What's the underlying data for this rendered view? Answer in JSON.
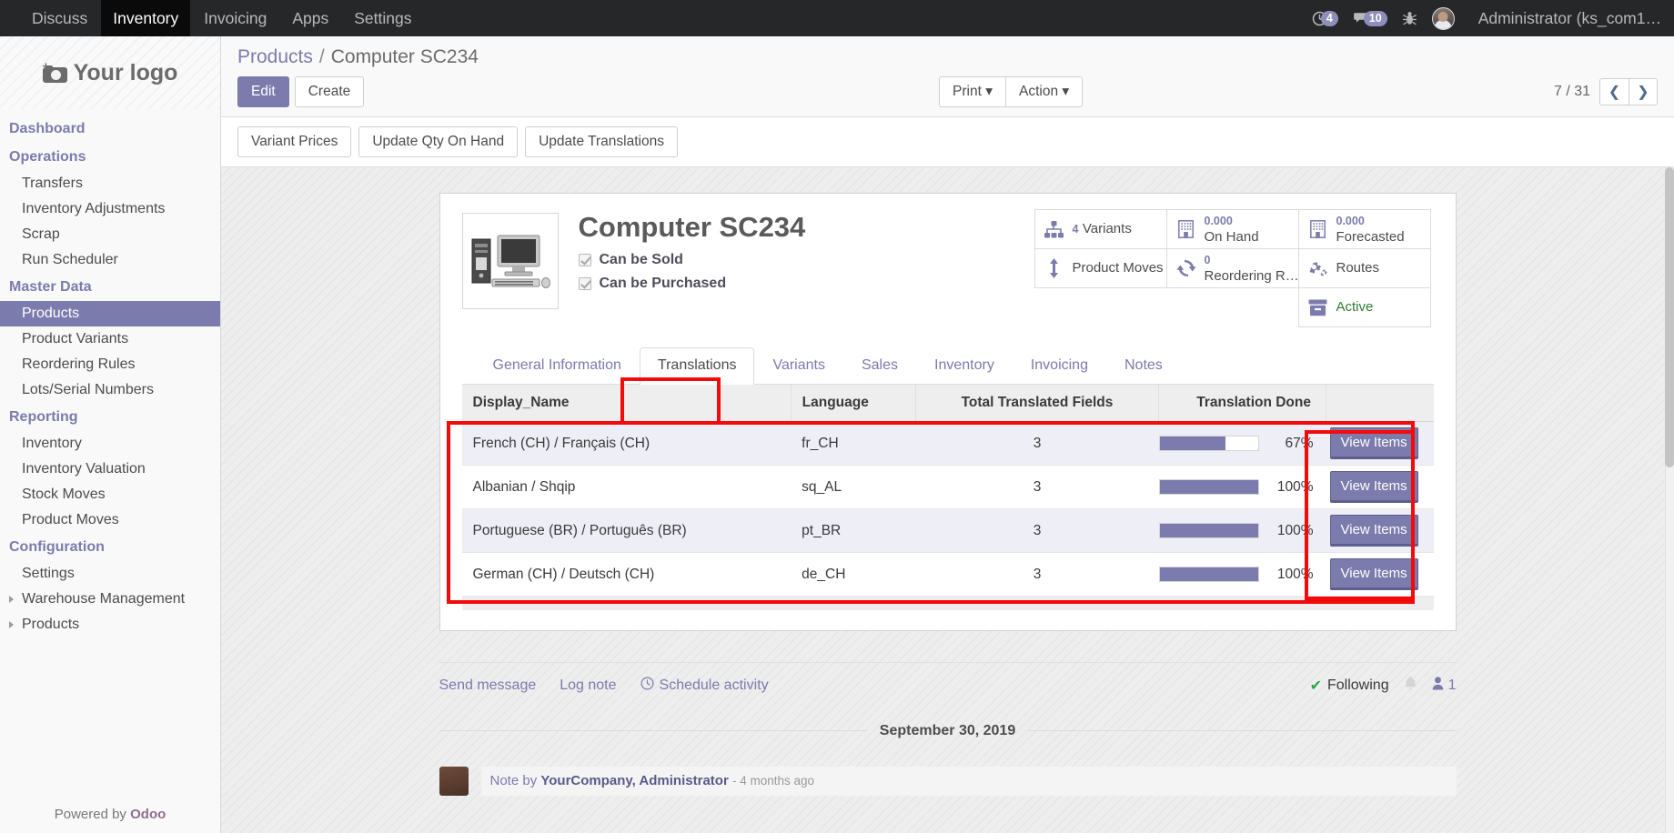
{
  "navbar": {
    "menus": [
      {
        "label": "Discuss",
        "active": false
      },
      {
        "label": "Inventory",
        "active": true
      },
      {
        "label": "Invoicing",
        "active": false
      },
      {
        "label": "Apps",
        "active": false
      },
      {
        "label": "Settings",
        "active": false
      }
    ],
    "activity_count": "4",
    "message_count": "10",
    "debug_icon": "bug-icon",
    "user_label": "Administrator (ks_com1…"
  },
  "sidebar": {
    "logo_text": "Your logo",
    "logo_icon": "camera-add-icon",
    "sections": [
      {
        "type": "header",
        "label": "Dashboard"
      },
      {
        "type": "header",
        "label": "Operations"
      },
      {
        "type": "link",
        "label": "Transfers"
      },
      {
        "type": "link",
        "label": "Inventory Adjustments"
      },
      {
        "type": "link",
        "label": "Scrap"
      },
      {
        "type": "link",
        "label": "Run Scheduler"
      },
      {
        "type": "header",
        "label": "Master Data"
      },
      {
        "type": "link",
        "label": "Products",
        "selected": true
      },
      {
        "type": "link",
        "label": "Product Variants"
      },
      {
        "type": "link",
        "label": "Reordering Rules"
      },
      {
        "type": "link",
        "label": "Lots/Serial Numbers"
      },
      {
        "type": "header",
        "label": "Reporting"
      },
      {
        "type": "link",
        "label": "Inventory"
      },
      {
        "type": "link",
        "label": "Inventory Valuation"
      },
      {
        "type": "link",
        "label": "Stock Moves"
      },
      {
        "type": "link",
        "label": "Product Moves"
      },
      {
        "type": "header",
        "label": "Configuration"
      },
      {
        "type": "link",
        "label": "Settings"
      },
      {
        "type": "link",
        "label": "Warehouse Management",
        "expandable": true
      },
      {
        "type": "link",
        "label": "Products",
        "expandable": true
      }
    ],
    "powered_prefix": "Powered by ",
    "powered_brand": "Odoo"
  },
  "control_panel": {
    "breadcrumb_root": "Products",
    "breadcrumb_sep": "/",
    "breadcrumb_current": "Computer SC234",
    "edit_label": "Edit",
    "create_label": "Create",
    "print_label": "Print",
    "action_label": "Action",
    "pager_text": "7 / 31",
    "prev_icon": "chevron-left-icon",
    "next_icon": "chevron-right-icon",
    "sub_buttons": [
      "Variant Prices",
      "Update Qty On Hand",
      "Update Translations"
    ]
  },
  "product": {
    "image_icon": "desktop-computer-image",
    "title": "Computer SC234",
    "checkboxes": [
      {
        "label": "Can be Sold",
        "checked": true
      },
      {
        "label": "Can be Purchased",
        "checked": true
      }
    ],
    "stats": [
      {
        "icon": "sitemap-icon",
        "value": "4",
        "label": "Variants"
      },
      {
        "icon": "building-icon",
        "value": "0.000",
        "label": "On Hand"
      },
      {
        "icon": "building-icon",
        "value": "0.000",
        "label": "Forecasted"
      },
      {
        "icon": "arrows-vertical-icon",
        "value": "",
        "label": "Product Moves"
      },
      {
        "icon": "refresh-icon",
        "value": "0",
        "label": "Reordering R…"
      },
      {
        "icon": "gears-icon",
        "value": "",
        "label": "Routes"
      },
      {
        "icon": "archive-icon",
        "value": "",
        "label": "Active",
        "green": true
      }
    ]
  },
  "tabs": [
    {
      "label": "General Information",
      "active": false
    },
    {
      "label": "Translations",
      "active": true
    },
    {
      "label": "Variants",
      "active": false
    },
    {
      "label": "Sales",
      "active": false
    },
    {
      "label": "Inventory",
      "active": false
    },
    {
      "label": "Invoicing",
      "active": false
    },
    {
      "label": "Notes",
      "active": false
    }
  ],
  "translations_table": {
    "columns": [
      "Display_Name",
      "Language",
      "Total Translated Fields",
      "Translation Done",
      ""
    ],
    "action_label": "View Items",
    "rows": [
      {
        "display_name": "French (CH) / Français (CH)",
        "language": "fr_CH",
        "total_fields": "3",
        "percent": "67%",
        "percent_value": 67
      },
      {
        "display_name": "Albanian / Shqip",
        "language": "sq_AL",
        "total_fields": "3",
        "percent": "100%",
        "percent_value": 100
      },
      {
        "display_name": "Portuguese (BR) / Português (BR)",
        "language": "pt_BR",
        "total_fields": "3",
        "percent": "100%",
        "percent_value": 100
      },
      {
        "display_name": "German (CH) / Deutsch (CH)",
        "language": "de_CH",
        "total_fields": "3",
        "percent": "100%",
        "percent_value": 100
      }
    ]
  },
  "chatter": {
    "send_message": "Send message",
    "log_note": "Log note",
    "schedule_activity": "Schedule activity",
    "schedule_icon": "clock-icon",
    "following_label": "Following",
    "bell_icon": "bell-icon",
    "followers_count": "1",
    "date_separator": "September 30, 2019",
    "message_author_prefix": "Note by ",
    "message_author": "YourCompany, Administrator",
    "message_ago": "- 4 months ago"
  },
  "colors": {
    "accent": "#7c7bad",
    "navbar_bg": "#262729",
    "annotation": "#f30b0b",
    "active_green": "#2e7d32"
  }
}
